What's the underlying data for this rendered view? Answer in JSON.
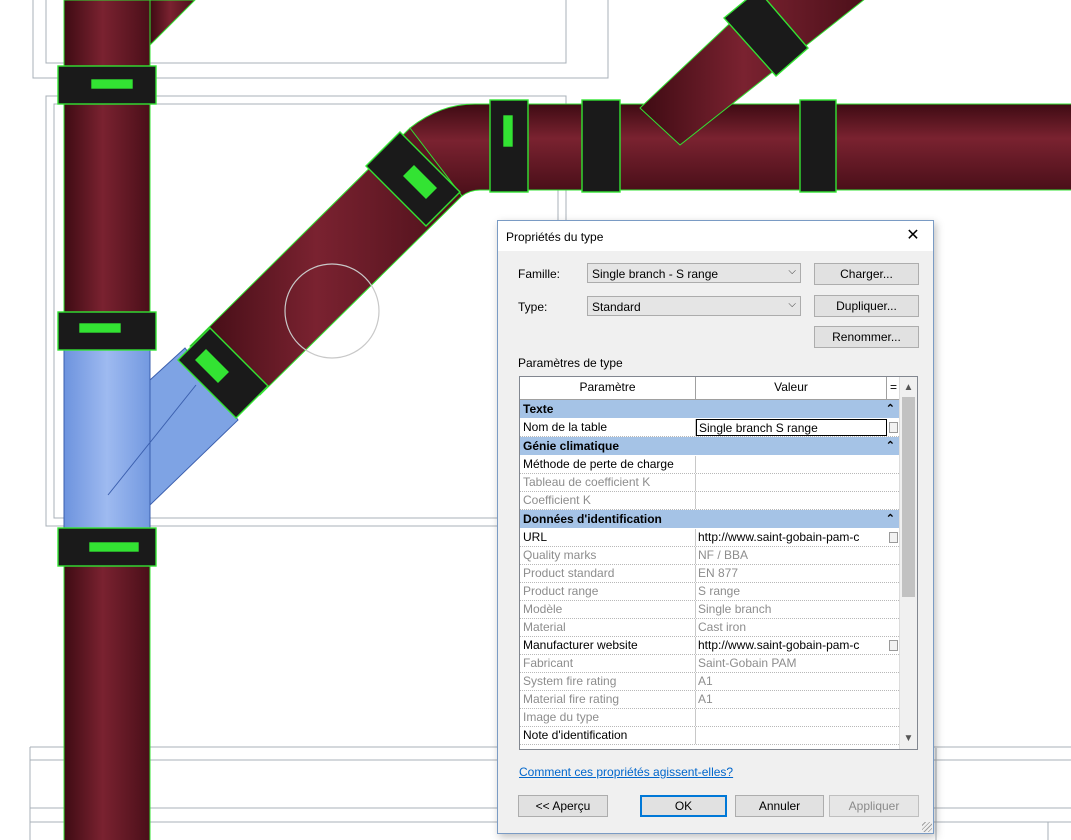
{
  "dialog": {
    "title": "Propriétés du type",
    "family_label": "Famille:",
    "family_value": "Single branch - S range",
    "type_label": "Type:",
    "type_value": "Standard",
    "load_button": "Charger...",
    "duplicate_button": "Dupliquer...",
    "rename_button": "Renommer...",
    "type_params_label": "Paramètres de type",
    "column_param": "Paramètre",
    "column_value": "Valeur",
    "column_eq": "=",
    "groups": [
      {
        "name": "Texte",
        "rows": [
          {
            "name": "Nom de la table",
            "value": "Single branch S range",
            "readonly": false
          }
        ]
      },
      {
        "name": "Génie climatique",
        "rows": [
          {
            "name": "Méthode de perte de charge",
            "value": "",
            "readonly": false
          },
          {
            "name": "Tableau de coefficient K",
            "value": "",
            "readonly": true
          },
          {
            "name": "Coefficient K",
            "value": "",
            "readonly": true
          }
        ]
      },
      {
        "name": "Données d'identification",
        "rows": [
          {
            "name": "URL",
            "value": "http://www.saint-gobain-pam-c",
            "readonly": false
          },
          {
            "name": "Quality marks",
            "value": "NF / BBA",
            "readonly": true
          },
          {
            "name": "Product standard",
            "value": "EN 877",
            "readonly": true
          },
          {
            "name": "Product range",
            "value": "S range",
            "readonly": true
          },
          {
            "name": "Modèle",
            "value": "Single branch",
            "readonly": true
          },
          {
            "name": "Material",
            "value": "Cast iron",
            "readonly": true
          },
          {
            "name": "Manufacturer website",
            "value": "http://www.saint-gobain-pam-c",
            "readonly": false
          },
          {
            "name": "Fabricant",
            "value": "Saint-Gobain PAM",
            "readonly": true
          },
          {
            "name": "System fire rating",
            "value": "A1",
            "readonly": true
          },
          {
            "name": "Material fire rating",
            "value": "A1",
            "readonly": true
          },
          {
            "name": "Image du type",
            "value": "",
            "readonly": true
          },
          {
            "name": "Note d'identification",
            "value": "",
            "readonly": false
          }
        ]
      }
    ],
    "help_link": "Comment ces propriétés agissent-elles?",
    "preview_button": "<< Aperçu",
    "ok_button": "OK",
    "cancel_button": "Annuler",
    "apply_button": "Appliquer"
  },
  "colors": {
    "pipe": "#6e1a26",
    "selection_outline": "#33e333",
    "highlighted_fitting": "#7ea3e4",
    "group_header": "#a5c3e6",
    "link": "#0066cc"
  }
}
